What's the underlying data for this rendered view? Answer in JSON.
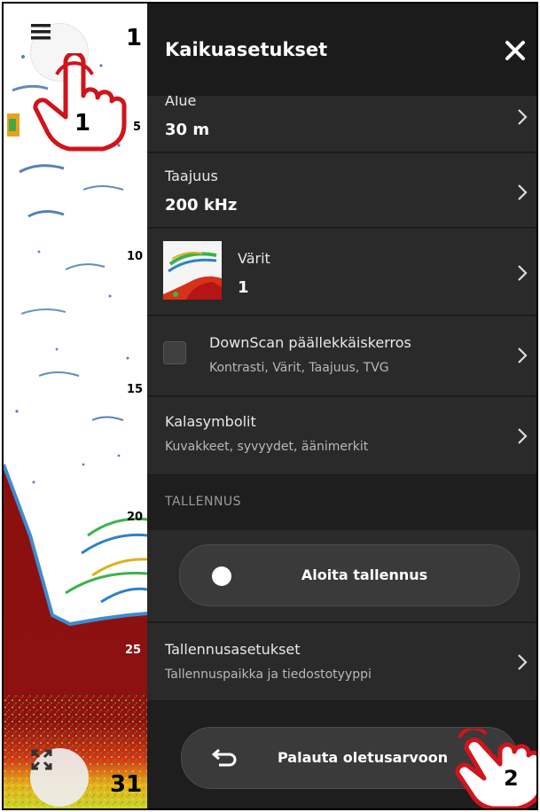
{
  "panel": {
    "title": "Kaikuasetukset",
    "close_icon": "close-icon"
  },
  "settings": {
    "range": {
      "label": "Alue",
      "value": "30 m"
    },
    "frequency": {
      "label": "Taajuus",
      "value": "200 kHz"
    },
    "colors": {
      "label": "Värit",
      "value": "1"
    },
    "downscan": {
      "label": "DownScan päällekkäiskerros",
      "sub": "Kontrasti, Värit, Taajuus, TVG",
      "checked": false
    },
    "fish_symbols": {
      "label": "Kalasymbolit",
      "sub": "Kuvakkeet, syvyydet, äänimerkit"
    }
  },
  "recording": {
    "section_label": "TALLENNUS",
    "start_label": "Aloita tallennus",
    "settings_label": "Tallennusasetukset",
    "settings_sub": "Tallennuspaikka ja tiedostotyyppi"
  },
  "reset": {
    "label": "Palauta oletusarvoon"
  },
  "sonar": {
    "depth_top": "1",
    "depth_marks": [
      "5",
      "10",
      "15",
      "20",
      "25"
    ],
    "depth_bottom": "31"
  },
  "callouts": [
    "1",
    "2"
  ],
  "colors": {
    "panel_bg": "#1e1e1e",
    "row_bg": "#2a2a2a",
    "bottom_red": "#8e1010",
    "callout_red": "#d0141c"
  }
}
